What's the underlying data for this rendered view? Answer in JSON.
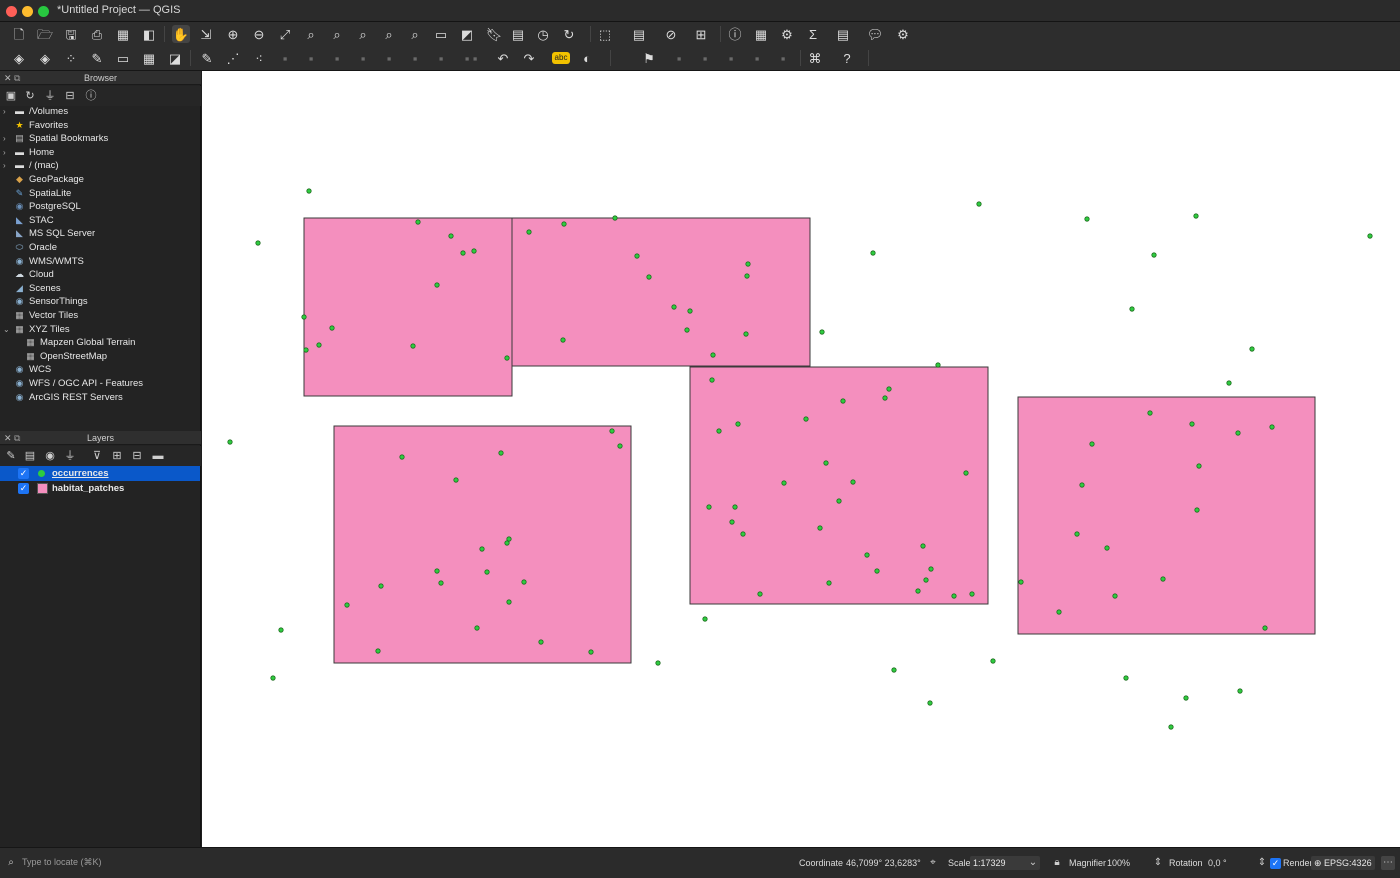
{
  "window": {
    "title": "*Untitled Project — QGIS"
  },
  "toolbar1": {
    "icons": [
      "new-project-icon",
      "open-project-icon",
      "save-project-icon",
      "new-print-layout-icon",
      "layout-manager-icon",
      "style-manager-icon",
      "pan-icon",
      "pan-to-selection-icon",
      "zoom-in-icon",
      "zoom-out-icon",
      "zoom-full-icon",
      "zoom-to-selection-icon",
      "zoom-to-layer-icon",
      "zoom-native-icon",
      "zoom-last-icon",
      "zoom-next-icon",
      "new-map-view-icon",
      "new-3d-map-icon",
      "new-bookmark-icon",
      "show-bookmarks-icon",
      "temporal-controller-icon",
      "refresh-icon",
      "select-features-icon",
      "select-by-value-icon",
      "deselect-icon",
      "attribute-table-icon",
      "identify-icon",
      "open-field-calculator-icon",
      "processing-toolbox-icon",
      "statistics-icon",
      "measure-icon",
      "map-tips-icon",
      "locator-options-icon"
    ]
  },
  "toolbar2": {
    "icons": [
      "data-source-manager-icon",
      "new-geopackage-layer-icon",
      "digitize-icon",
      "edit-pencil-icon",
      "new-temporary-layer-icon",
      "add-raster-icon",
      "add-wms-icon",
      "label-tool-icon",
      "add-feature-icon",
      "vertex-tool-icon",
      "undo-icon",
      "redo-icon",
      "label-abc-icon",
      "label-highlight-icon",
      "pin-label-icon",
      "python-console-icon",
      "help-icon"
    ]
  },
  "browser": {
    "title": "Browser",
    "items": [
      {
        "label": "/Volumes",
        "icon": "folder-icon",
        "expandable": true,
        "indent": 0
      },
      {
        "label": "Favorites",
        "icon": "star-icon",
        "expandable": false,
        "indent": 0
      },
      {
        "label": "Spatial Bookmarks",
        "icon": "bookmark-icon",
        "expandable": true,
        "indent": 0
      },
      {
        "label": "Home",
        "icon": "folder-icon",
        "expandable": true,
        "indent": 0
      },
      {
        "label": "/ (mac)",
        "icon": "folder-icon",
        "expandable": true,
        "indent": 0
      },
      {
        "label": "GeoPackage",
        "icon": "geopackage-icon",
        "expandable": false,
        "indent": 0
      },
      {
        "label": "SpatiaLite",
        "icon": "spatialite-icon",
        "expandable": false,
        "indent": 0
      },
      {
        "label": "PostgreSQL",
        "icon": "postgresql-icon",
        "expandable": false,
        "indent": 0
      },
      {
        "label": "STAC",
        "icon": "stac-icon",
        "expandable": false,
        "indent": 0
      },
      {
        "label": "MS SQL Server",
        "icon": "mssql-icon",
        "expandable": false,
        "indent": 0
      },
      {
        "label": "Oracle",
        "icon": "oracle-icon",
        "expandable": false,
        "indent": 0
      },
      {
        "label": "WMS/WMTS",
        "icon": "wms-icon",
        "expandable": false,
        "indent": 0
      },
      {
        "label": "Cloud",
        "icon": "cloud-icon",
        "expandable": false,
        "indent": 0
      },
      {
        "label": "Scenes",
        "icon": "scenes-icon",
        "expandable": false,
        "indent": 0
      },
      {
        "label": "SensorThings",
        "icon": "sensorthings-icon",
        "expandable": false,
        "indent": 0
      },
      {
        "label": "Vector Tiles",
        "icon": "vector-tiles-icon",
        "expandable": false,
        "indent": 0
      },
      {
        "label": "XYZ Tiles",
        "icon": "xyz-tiles-icon",
        "expandable": true,
        "expanded": true,
        "indent": 0
      },
      {
        "label": "Mapzen Global Terrain",
        "icon": "tiles-icon",
        "expandable": false,
        "indent": 1
      },
      {
        "label": "OpenStreetMap",
        "icon": "tiles-icon",
        "expandable": false,
        "indent": 1
      },
      {
        "label": "WCS",
        "icon": "wcs-icon",
        "expandable": false,
        "indent": 0
      },
      {
        "label": "WFS / OGC API - Features",
        "icon": "wfs-icon",
        "expandable": false,
        "indent": 0
      },
      {
        "label": "ArcGIS REST Servers",
        "icon": "arcgis-icon",
        "expandable": false,
        "indent": 0
      }
    ]
  },
  "layers": {
    "title": "Layers",
    "items": [
      {
        "name": "occurrences",
        "checked": true,
        "selected": true,
        "symbol": "point",
        "color": "#2ecc40"
      },
      {
        "name": "habitat_patches",
        "checked": true,
        "selected": false,
        "symbol": "polygon",
        "color": "#f48fbe"
      }
    ]
  },
  "map": {
    "background": "#ffffff",
    "polygon_fill": "#f48fbe",
    "polygon_stroke": "#3a3a3a",
    "point_fill": "#2ecc40",
    "point_stroke": "#1e6b1e"
  },
  "statusbar": {
    "locator_placeholder": "Type to locate (⌘K)",
    "coordinate_label": "Coordinate",
    "coordinate_value": "46,7099° 23,6283°",
    "scale_label": "Scale",
    "scale_value": "1:17329",
    "magnifier_label": "Magnifier",
    "magnifier_value": "100%",
    "rotation_label": "Rotation",
    "rotation_value": "0,0 °",
    "render_label": "Render",
    "render_checked": true,
    "crs": "EPSG:4326"
  }
}
